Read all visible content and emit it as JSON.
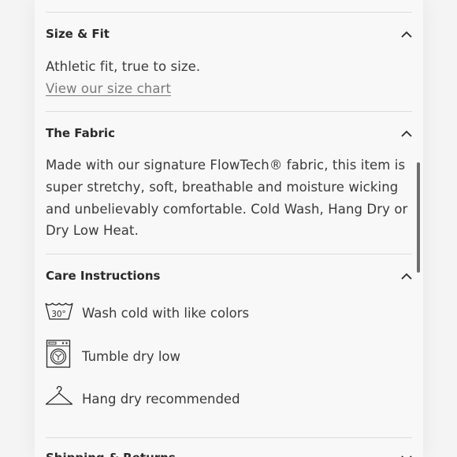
{
  "size_fit": {
    "title": "Size & Fit",
    "body": "Athletic fit, true to size.",
    "link": "View our size chart",
    "chevron_icon": "chevron-up-icon"
  },
  "fabric": {
    "title": "The Fabric",
    "body": "Made with our signature FlowTech® fabric, this item is super stretchy, soft, breathable and moisture wicking and unbelievably comfortable. Cold Wash, Hang Dry or Dry Low Heat.",
    "chevron_icon": "chevron-up-icon"
  },
  "care": {
    "title": "Care Instructions",
    "chevron_icon": "chevron-up-icon",
    "items": [
      {
        "label": "Wash cold with like colors",
        "icon": "wash-30-icon",
        "icon_text": "30°"
      },
      {
        "label": "Tumble dry low",
        "icon": "tumble-dry-icon"
      },
      {
        "label": "Hang dry recommended",
        "icon": "hanger-icon"
      }
    ]
  },
  "shipping": {
    "title": "Shipping & Returns",
    "chevron_icon": "chevron-down-icon"
  },
  "colors": {
    "divider": "#dcdcdc",
    "scrollbar": "#6e6e6e",
    "link": "#7a7a7a"
  }
}
